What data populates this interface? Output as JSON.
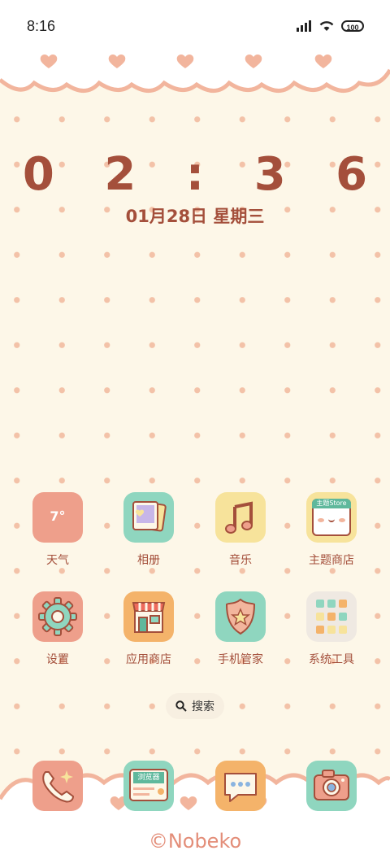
{
  "status": {
    "time": "8:16",
    "battery": "100"
  },
  "clock": {
    "time": "0 2 : 3 6",
    "date": "01月28日 星期三"
  },
  "apps_row1": [
    {
      "label": "天气",
      "icon": "weather-icon",
      "badge": "7°",
      "color": "#ee9f8b"
    },
    {
      "label": "相册",
      "icon": "photo-album-icon",
      "color": "#8fd6bf"
    },
    {
      "label": "音乐",
      "icon": "music-note-icon",
      "color": "#f7e39b"
    },
    {
      "label": "主题商店",
      "icon": "theme-store-icon",
      "badge": "主题Store",
      "color": "#f7e39b"
    }
  ],
  "apps_row2": [
    {
      "label": "设置",
      "icon": "gear-icon",
      "color": "#ee9f8b"
    },
    {
      "label": "应用商店",
      "icon": "app-store-icon",
      "color": "#f4b36a"
    },
    {
      "label": "手机管家",
      "icon": "shield-icon",
      "color": "#8fd6bf"
    },
    {
      "label": "系统工具",
      "icon": "folder-icon",
      "color": "#efe9e2"
    }
  ],
  "search": {
    "label": "搜索"
  },
  "dock": [
    {
      "icon": "phone-icon",
      "color": "#ee9f8b"
    },
    {
      "icon": "browser-icon",
      "badge": "浏览器",
      "color": "#8fd6bf"
    },
    {
      "icon": "messages-icon",
      "color": "#f4b36a"
    },
    {
      "icon": "camera-icon",
      "color": "#8fd6bf"
    }
  ],
  "watermark": "©Nobeko"
}
